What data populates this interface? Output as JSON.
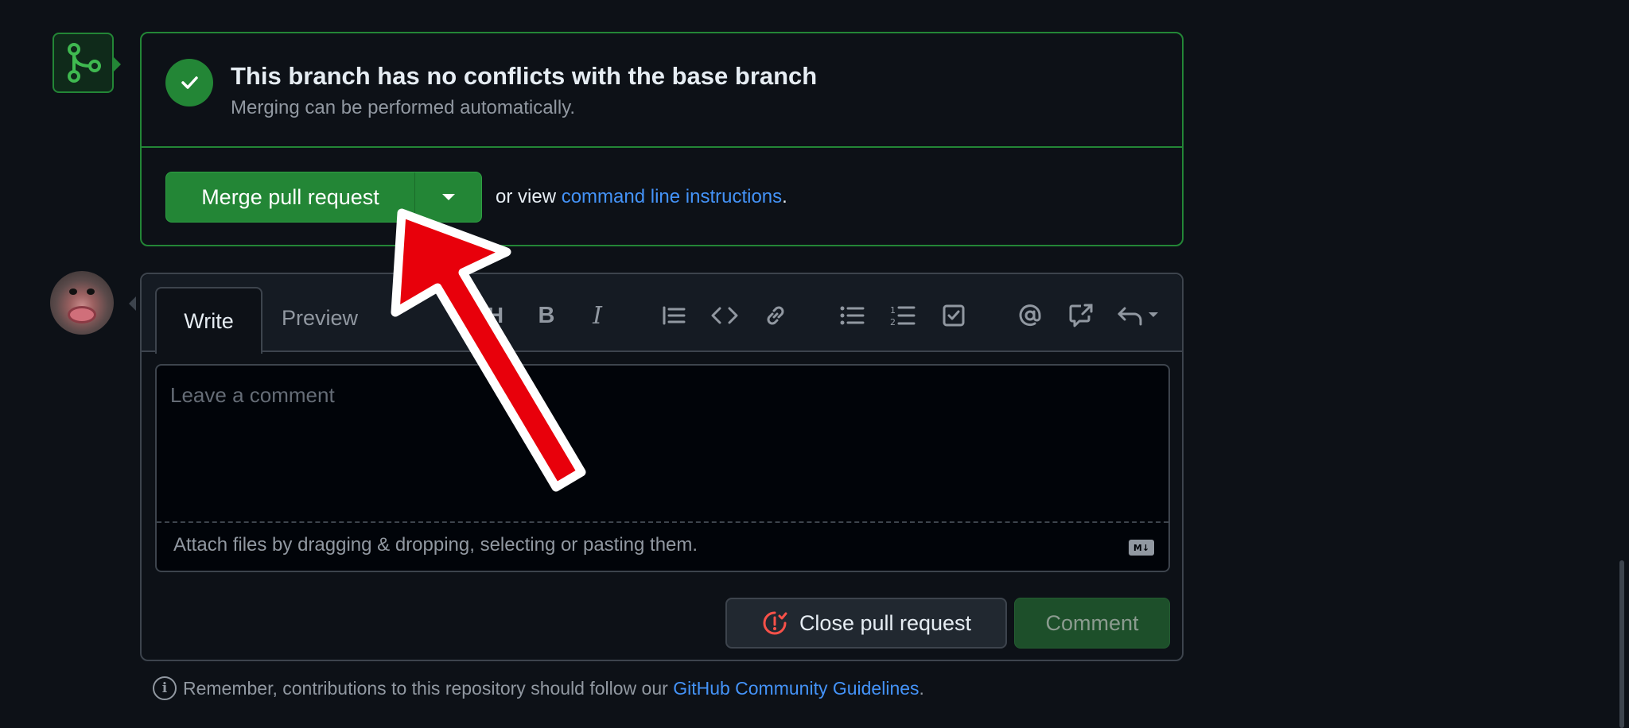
{
  "merge": {
    "title": "This branch has no conflicts with the base branch",
    "subtitle": "Merging can be performed automatically.",
    "merge_button": "Merge pull request",
    "or_view_prefix": "or view ",
    "command_link": "command line instructions",
    "or_view_suffix": "."
  },
  "editor": {
    "tab_write": "Write",
    "tab_preview": "Preview",
    "toolbar": {
      "heading": "H",
      "bold": "B",
      "italic": "I"
    },
    "placeholder": "Leave a comment",
    "attach_text": "Attach files by dragging & dropping, selecting or pasting them.",
    "markdown_badge": "M↓"
  },
  "actions": {
    "close_label": "Close pull request",
    "comment_label": "Comment"
  },
  "footer": {
    "prefix": "Remember, contributions to this repository should follow our ",
    "link": "GitHub Community Guidelines",
    "suffix": "."
  },
  "colors": {
    "background": "#0d1117",
    "success": "#238636",
    "link": "#4493f8",
    "border": "#3d444d",
    "annotation_arrow": "#e8000b"
  },
  "icons": {
    "merge_status": "git-merge-icon",
    "check": "check-circle-icon",
    "close_pr": "git-pull-request-closed-icon",
    "info": "info-icon"
  }
}
